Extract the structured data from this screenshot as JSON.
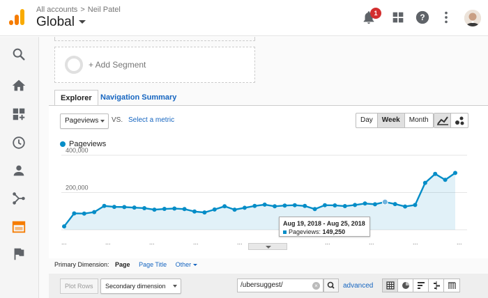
{
  "header": {
    "breadcrumb": [
      "All accounts",
      "Neil Patel"
    ],
    "breadcrumb_sep": ">",
    "property": "Global",
    "notification_count": "1",
    "icons": [
      "notifications-icon",
      "apps-grid-icon",
      "help-icon",
      "more-vert-icon"
    ]
  },
  "sidebar": {
    "items": [
      "search-icon",
      "home-icon",
      "customization-icon",
      "realtime-clock-icon",
      "audience-person-icon",
      "acquisition-icon",
      "behavior-icon",
      "conversions-flag-icon"
    ],
    "active_index": 6,
    "active_color": "#f57c00"
  },
  "segment": {
    "add_label": "+ Add Segment"
  },
  "tabs": {
    "explorer": "Explorer",
    "navigation": "Navigation Summary"
  },
  "controls": {
    "metric": "Pageviews",
    "vs": "VS.",
    "select_metric": "Select a metric",
    "granularity": [
      "Day",
      "Week",
      "Month"
    ],
    "active_granularity": "Week",
    "chart_types": [
      "line-chart-icon",
      "motion-chart-icon"
    ]
  },
  "chart_data": {
    "type": "line",
    "series": [
      {
        "name": "Pageviews",
        "color": "#058dc7",
        "values": [
          18000,
          88000,
          87000,
          95000,
          128000,
          123000,
          122000,
          119000,
          116000,
          108000,
          112000,
          114000,
          111000,
          98000,
          93000,
          109000,
          126000,
          108000,
          118000,
          128000,
          135000,
          126000,
          130000,
          132000,
          128000,
          111000,
          132000,
          131000,
          127000,
          133000,
          141000,
          137000,
          149250,
          138000,
          125000,
          133000,
          252000,
          300000,
          268000,
          305000
        ]
      }
    ],
    "ylim": [
      0,
      400000
    ],
    "yticks": [
      "200,000",
      "400,000"
    ],
    "grid": true,
    "legend": "top-left",
    "highlight_index": 32
  },
  "tooltip": {
    "range": "Aug 19, 2018 - Aug 25, 2018",
    "metric_label": "Pageviews:",
    "metric_value": "149,250"
  },
  "primary_dimension": {
    "label": "Primary Dimension:",
    "selected": "Page",
    "options": [
      "Page Title",
      "Other"
    ]
  },
  "table_controls": {
    "plot_rows": "Plot Rows",
    "secondary_dimension": "Secondary dimension",
    "filter_value": "/ubersuggest/",
    "advanced": "advanced",
    "views": [
      "data-table-icon",
      "pie-icon",
      "performance-icon",
      "comparison-icon",
      "pivot-icon"
    ]
  }
}
